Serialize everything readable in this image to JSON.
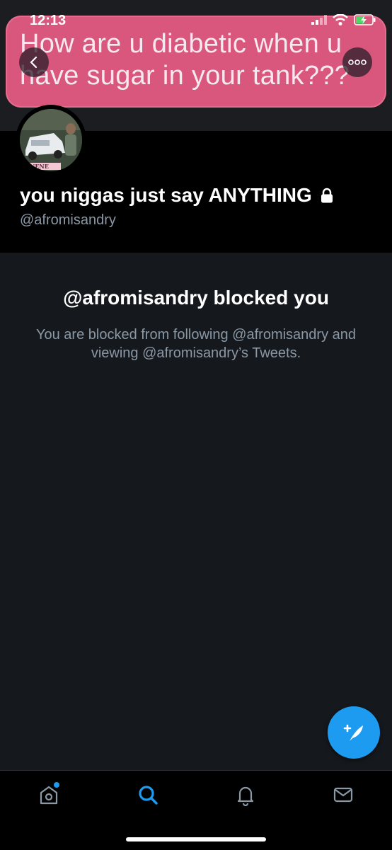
{
  "status_bar": {
    "time": "12:13"
  },
  "banner": {
    "text": "How are u diabetic when u have sugar in your tank???"
  },
  "avatar_caption": "NENE",
  "profile": {
    "display_name": "you niggas just say ANYTHING",
    "handle": "@afromisandry"
  },
  "blocked": {
    "title": "@afromisandry blocked you",
    "description": "You are blocked from following @afromisandry and viewing @afromisandry’s Tweets."
  },
  "tabs": [
    "home-icon",
    "search-icon",
    "bell-icon",
    "mail-icon"
  ],
  "colors": {
    "accent": "#1d9bf0",
    "banner": "#d9577c",
    "background": "#15181c"
  }
}
